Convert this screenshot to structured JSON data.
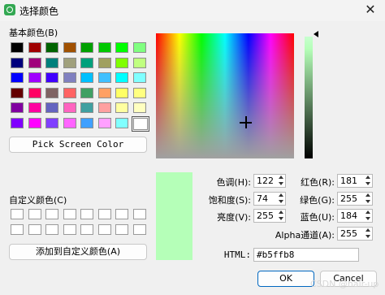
{
  "window": {
    "title": "选择颜色",
    "close_glyph": "✕"
  },
  "basic": {
    "label": "基本颜色(B)",
    "swatches": [
      [
        "#000000",
        "#a00000",
        "#006400",
        "#a05000",
        "#00a000",
        "#00c800",
        "#00ff00",
        "#80ff80"
      ],
      [
        "#00007c",
        "#a0007c",
        "#00807c",
        "#a0a07c",
        "#00a07c",
        "#a0a060",
        "#80ff00",
        "#c0ff80"
      ],
      [
        "#0000ff",
        "#a000ff",
        "#4000ff",
        "#8080c0",
        "#00c0ff",
        "#40c0ff",
        "#00ffff",
        "#80ffff"
      ],
      [
        "#640000",
        "#ff0064",
        "#806464",
        "#ff6464",
        "#40a064",
        "#ffa064",
        "#ffff64",
        "#ffff80"
      ],
      [
        "#8000a0",
        "#ff00a0",
        "#6464c0",
        "#ff64c0",
        "#40a0a0",
        "#ffa0a0",
        "#ffffa0",
        "#ffffc0"
      ],
      [
        "#8000ff",
        "#ff00ff",
        "#8040ff",
        "#ff64ff",
        "#40a0ff",
        "#ffa0ff",
        "#80ffff",
        "#ffffff"
      ]
    ]
  },
  "pick_button": "Pick Screen Color",
  "custom": {
    "label": "自定义颜色(C)",
    "swatch_count": 16
  },
  "add_button": "添加到自定义颜色(A)",
  "fields": {
    "hue": {
      "label": "色调(H):",
      "value": "122"
    },
    "sat": {
      "label": "饱和度(S):",
      "value": "74"
    },
    "val": {
      "label": "亮度(V):",
      "value": "255"
    },
    "red": {
      "label": "红色(R):",
      "value": "181"
    },
    "green": {
      "label": "绿色(G):",
      "value": "255"
    },
    "blue": {
      "label": "蓝色(U):",
      "value": "184"
    },
    "alpha": {
      "label": "Alpha通道(A):",
      "value": "255"
    },
    "html": {
      "label": "HTML:",
      "value": "#b5ffb8"
    }
  },
  "current_color": "#b5ffb8",
  "buttons": {
    "ok": "OK",
    "cancel": "Cancel"
  },
  "watermark": "CSDN @hair-up"
}
